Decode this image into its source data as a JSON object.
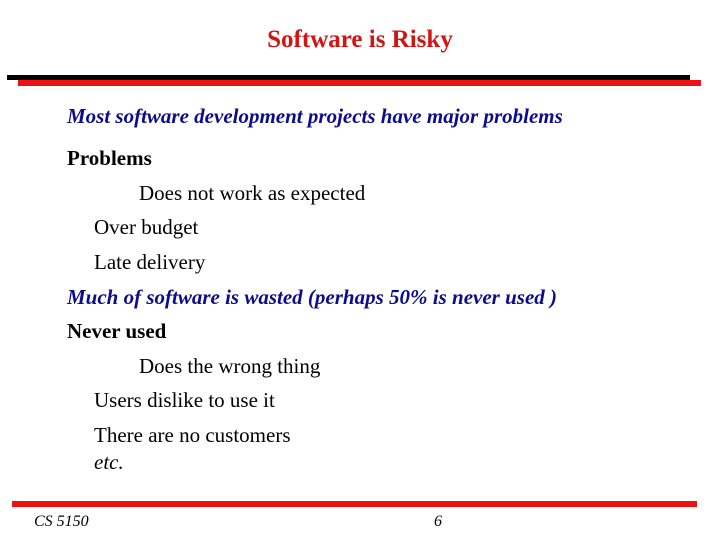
{
  "slide": {
    "title": "Software is Risky",
    "colors": {
      "title": "#d21414",
      "emphasis": "#0c0c8c",
      "rule_red": "#ee1111",
      "rule_black": "#000000"
    },
    "lines": [
      {
        "text": "Most software development projects have major problems",
        "style": "emphasis",
        "level": 0
      },
      {
        "text": "Problems",
        "style": "bold",
        "level": 0
      },
      {
        "text": "Does not work as expected",
        "style": "normal",
        "level": 2
      },
      {
        "text": "Over budget",
        "style": "normal",
        "level": 1
      },
      {
        "text": "Late delivery",
        "style": "normal",
        "level": 1
      },
      {
        "text": "Much of software is wasted (perhaps 50% is never used )",
        "style": "emphasis",
        "level": 0
      },
      {
        "text": "Never used",
        "style": "bold",
        "level": 0
      },
      {
        "text": "Does the wrong thing",
        "style": "normal",
        "level": 2
      },
      {
        "text": "Users dislike to use it",
        "style": "normal",
        "level": 1
      },
      {
        "text": "There are no customers",
        "style": "normal",
        "level": 1
      },
      {
        "text": "etc.",
        "style": "italic",
        "level": 1
      }
    ]
  },
  "footer": {
    "course": "CS 5150",
    "page_number": "6"
  }
}
